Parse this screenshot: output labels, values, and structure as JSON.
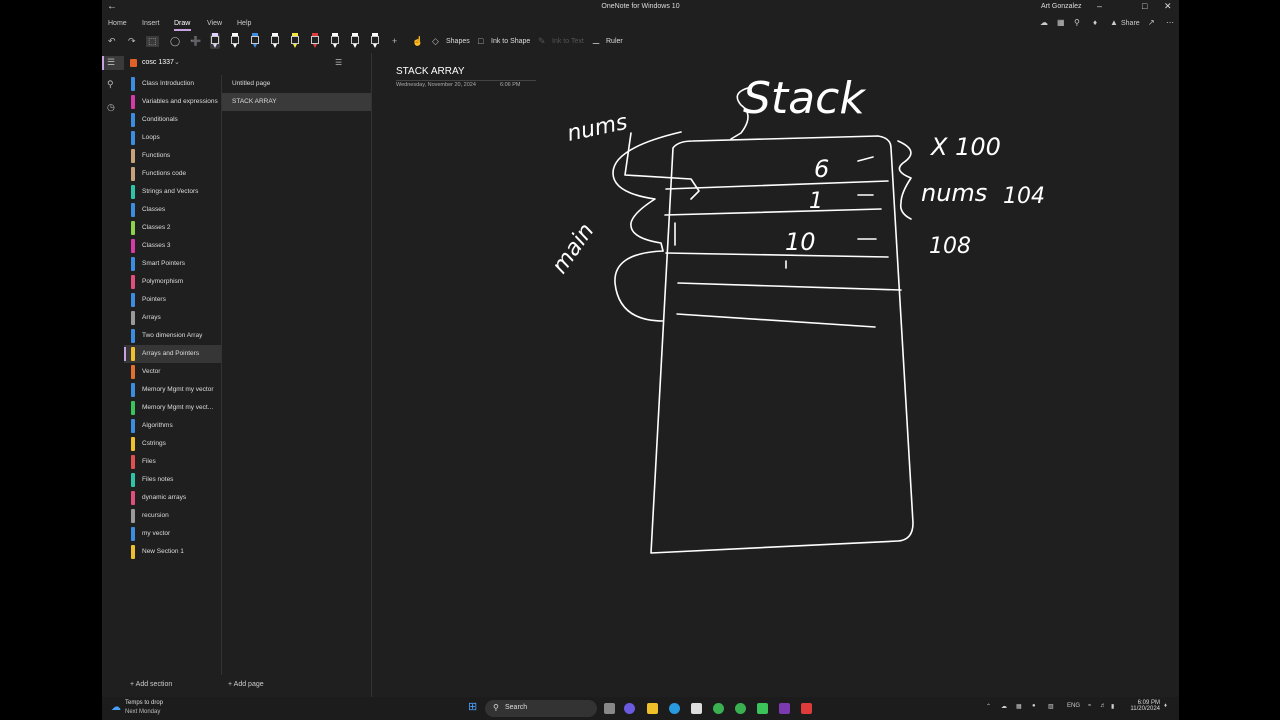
{
  "window": {
    "title": "OneNote for Windows 10",
    "user": "Art Gonzalez"
  },
  "menu": {
    "items": [
      {
        "label": "Home",
        "active": false
      },
      {
        "label": "Insert",
        "active": false
      },
      {
        "label": "Draw",
        "active": true
      },
      {
        "label": "View",
        "active": false
      },
      {
        "label": "Help",
        "active": false
      }
    ],
    "share_label": "Share"
  },
  "toolbar": {
    "shapes_label": "Shapes",
    "ink_to_shape_label": "Ink to Shape",
    "ink_to_text_label": "Ink to Text",
    "ruler_label": "Ruler",
    "pens": [
      {
        "name": "pen-1",
        "color": "#e0d0ff",
        "selected": true
      },
      {
        "name": "pen-2",
        "color": "#ffffff"
      },
      {
        "name": "pen-3",
        "color": "#3b8de0"
      },
      {
        "name": "pen-4",
        "color": "#ffffff"
      },
      {
        "name": "highlighter-yellow",
        "color": "#f5e63a"
      },
      {
        "name": "pen-6",
        "color": "#e03b3b"
      },
      {
        "name": "pen-7",
        "color": "#ffffff"
      },
      {
        "name": "pen-8",
        "color": "#ffffff"
      },
      {
        "name": "pen-9",
        "color": "#ffffff"
      },
      {
        "name": "pen-10",
        "color": "#ffffff"
      }
    ]
  },
  "notebook": {
    "name": "cosc 1337"
  },
  "sections": [
    {
      "label": "Class Introduction",
      "color": "#3b8de0"
    },
    {
      "label": "Variables and expressions",
      "color": "#d63aa8"
    },
    {
      "label": "Conditionals",
      "color": "#3b8de0"
    },
    {
      "label": "Loops",
      "color": "#3b8de0"
    },
    {
      "label": "Functions",
      "color": "#c7a27a"
    },
    {
      "label": "Functions code",
      "color": "#c7a27a"
    },
    {
      "label": "Strings and Vectors",
      "color": "#2ec4a8"
    },
    {
      "label": "Classes",
      "color": "#3b8de0"
    },
    {
      "label": "Classes 2",
      "color": "#8bd34a"
    },
    {
      "label": "Classes 3",
      "color": "#d63aa8"
    },
    {
      "label": "Smart Pointers",
      "color": "#3b8de0"
    },
    {
      "label": "Polymorphism",
      "color": "#e0507a"
    },
    {
      "label": "Pointers",
      "color": "#3b8de0"
    },
    {
      "label": "Arrays",
      "color": "#9a9a9a"
    },
    {
      "label": "Two dimension Array",
      "color": "#3b8de0"
    },
    {
      "label": "Arrays and Pointers",
      "color": "#f0c02a",
      "selected": true
    },
    {
      "label": "Vector",
      "color": "#e07030"
    },
    {
      "label": "Memory Mgmt my vector",
      "color": "#3b8de0"
    },
    {
      "label": "Memory Mgmt my vect...",
      "color": "#3ac45a"
    },
    {
      "label": "Algorithms",
      "color": "#3b8de0"
    },
    {
      "label": "Cstrings",
      "color": "#f0c02a"
    },
    {
      "label": "Files",
      "color": "#e05050"
    },
    {
      "label": "Files notes",
      "color": "#2ec4a8"
    },
    {
      "label": "dynamic arrays",
      "color": "#e0507a"
    },
    {
      "label": "recursion",
      "color": "#9a9a9a"
    },
    {
      "label": "my vector",
      "color": "#3b8de0"
    },
    {
      "label": "New Section 1",
      "color": "#f0c02a"
    }
  ],
  "pages": [
    {
      "label": "Untitled page",
      "selected": false
    },
    {
      "label": "STACK ARRAY",
      "selected": true
    }
  ],
  "footer": {
    "add_section": "Add section",
    "add_page": "Add page"
  },
  "page": {
    "title": "STACK ARRAY",
    "date": "Wednesday, November 20, 2024",
    "time": "6:06 PM"
  },
  "ink": {
    "stack": "Stack",
    "nums_top": "nums",
    "main": "main",
    "x_label": "X 100",
    "nums_right": "nums",
    "addr_104": "104",
    "addr_108": "108",
    "val_6": "6",
    "val_1": "1",
    "val_10": "10"
  },
  "taskbar": {
    "weather_line1": "Temps to drop",
    "weather_line2": "Next Monday",
    "search_label": "Search",
    "language": "ENG",
    "time": "6:09 PM",
    "date": "11/20/2024"
  }
}
